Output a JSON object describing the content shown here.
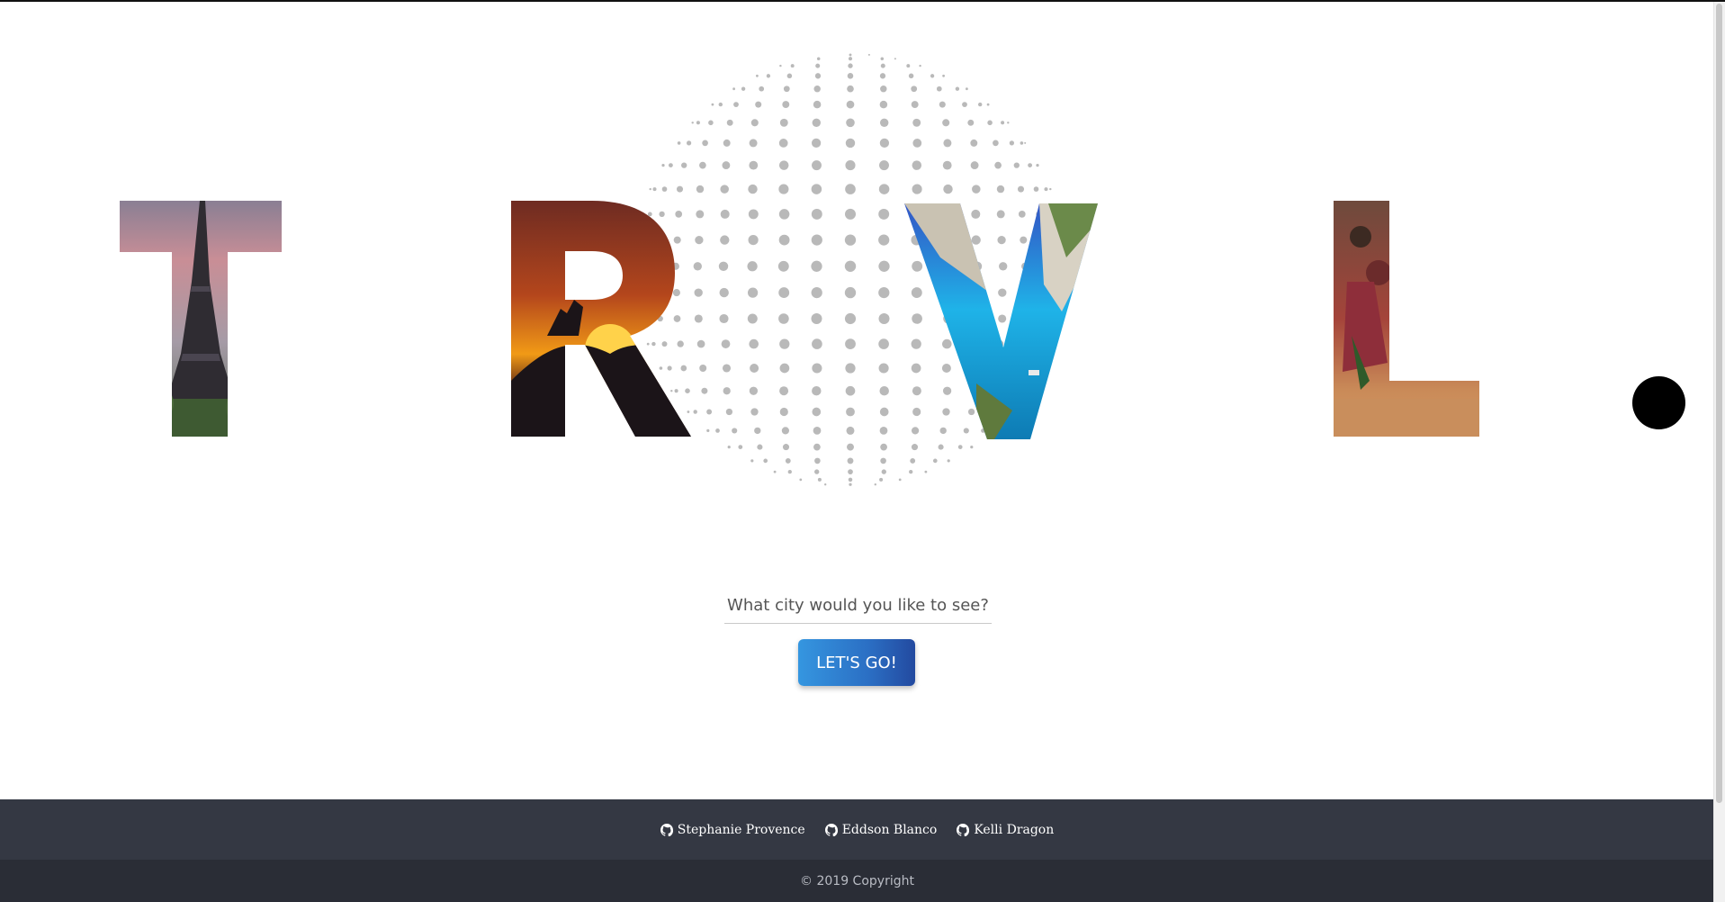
{
  "brand": {
    "letters": [
      "T",
      "R",
      "V",
      "L"
    ],
    "dot_color": "#000000"
  },
  "search": {
    "placeholder": "What city would you like to see?",
    "value": ""
  },
  "cta": {
    "label": "LET'S GO!",
    "color": "#2b6fc4"
  },
  "footer": {
    "links": [
      {
        "icon": "github-icon",
        "label": "Stephanie Provence"
      },
      {
        "icon": "github-icon",
        "label": "Eddson Blanco"
      },
      {
        "icon": "github-icon",
        "label": "Kelli Dragon"
      }
    ],
    "copyright": "© 2019 Copyright",
    "bg_color": "#343843",
    "bottom_bg_color": "#2a2d36"
  }
}
